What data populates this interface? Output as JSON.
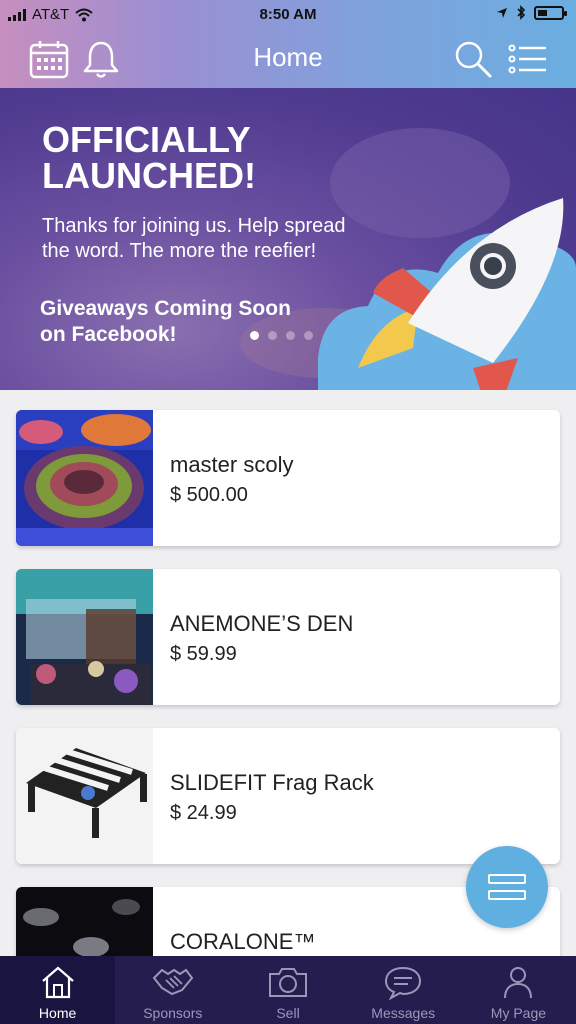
{
  "status_bar": {
    "carrier": "AT&T",
    "time": "8:50 AM"
  },
  "nav": {
    "title": "Home"
  },
  "banner": {
    "headline_1": "OFFICIALLY",
    "headline_2": "LAUNCHED!",
    "subtext_1": "Thanks for joining us. Help spread",
    "subtext_2": "the word.  The more the reefier!",
    "giveaway_1": "Giveaways Coming Soon",
    "giveaway_2": "on Facebook!",
    "carousel": {
      "pages": 4,
      "current": 1
    }
  },
  "products": [
    {
      "name": "master scoly",
      "price": "$ 500.00"
    },
    {
      "name": "ANEMONE’S DEN",
      "price": "$ 59.99"
    },
    {
      "name": "SLIDEFIT Frag Rack",
      "price": "$ 24.99"
    },
    {
      "name": "CORALONE™",
      "price": ""
    }
  ],
  "tabs": [
    {
      "label": "Home",
      "icon": "home-icon",
      "active": true
    },
    {
      "label": "Sponsors",
      "icon": "handshake-icon",
      "active": false
    },
    {
      "label": "Sell",
      "icon": "camera-icon",
      "active": false
    },
    {
      "label": "Messages",
      "icon": "chat-icon",
      "active": false
    },
    {
      "label": "My Page",
      "icon": "person-icon",
      "active": false
    }
  ],
  "colors": {
    "accent": "#5fb0e0",
    "tabbar": "#261d4f",
    "tabbar_active": "#1a1440"
  }
}
